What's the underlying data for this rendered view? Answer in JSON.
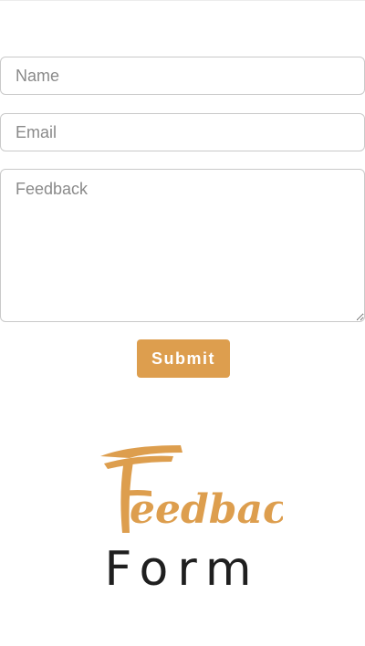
{
  "form": {
    "name_placeholder": "Name",
    "email_placeholder": "Email",
    "feedback_placeholder": "Feedback",
    "submit_label": "Submit"
  },
  "branding": {
    "script_word": "Feedback",
    "word": "Form"
  },
  "colors": {
    "accent": "#dd9e4e",
    "text_dark": "#1f1f1f",
    "border": "#c9c9c9",
    "placeholder": "#8a8a8a"
  }
}
